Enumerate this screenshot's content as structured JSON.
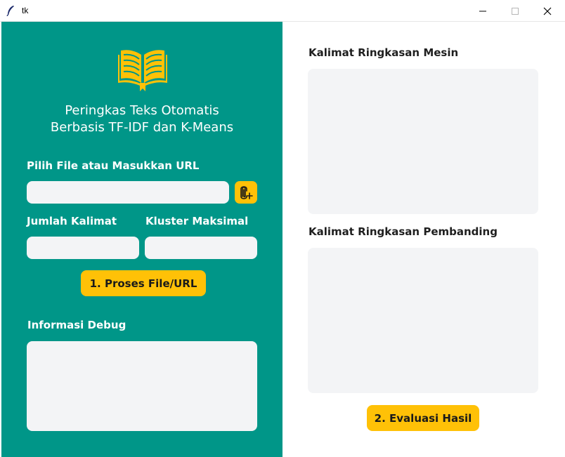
{
  "window": {
    "title": "tk",
    "icons": {
      "app": "feather-icon",
      "minimize": "minimize-icon",
      "maximize": "maximize-icon",
      "close": "close-icon"
    }
  },
  "left_panel": {
    "logo_icon": "book-icon",
    "title_line1": "Peringkas Teks Otomatis",
    "title_line2": "Berbasis TF-IDF dan K-Means",
    "file_label": "Pilih File atau Masukkan URL",
    "file_input_value": "",
    "attach_icon": "attach-file-icon",
    "sentence_count_label": "Jumlah Kalimat",
    "sentence_count_value": "",
    "max_cluster_label": "Kluster Maksimal",
    "max_cluster_value": "",
    "process_button": "1. Proses File/URL",
    "debug_label": "Informasi Debug",
    "debug_text": ""
  },
  "right_panel": {
    "machine_summary_label": "Kalimat Ringkasan Mesin",
    "machine_summary_text": "",
    "reference_summary_label": "Kalimat Ringkasan Pembanding",
    "reference_summary_text": "",
    "evaluate_button": "2. Evaluasi Hasil"
  },
  "colors": {
    "panel_teal": "#009688",
    "accent_yellow": "#ffc107",
    "field_bg": "#f3f4f6"
  }
}
